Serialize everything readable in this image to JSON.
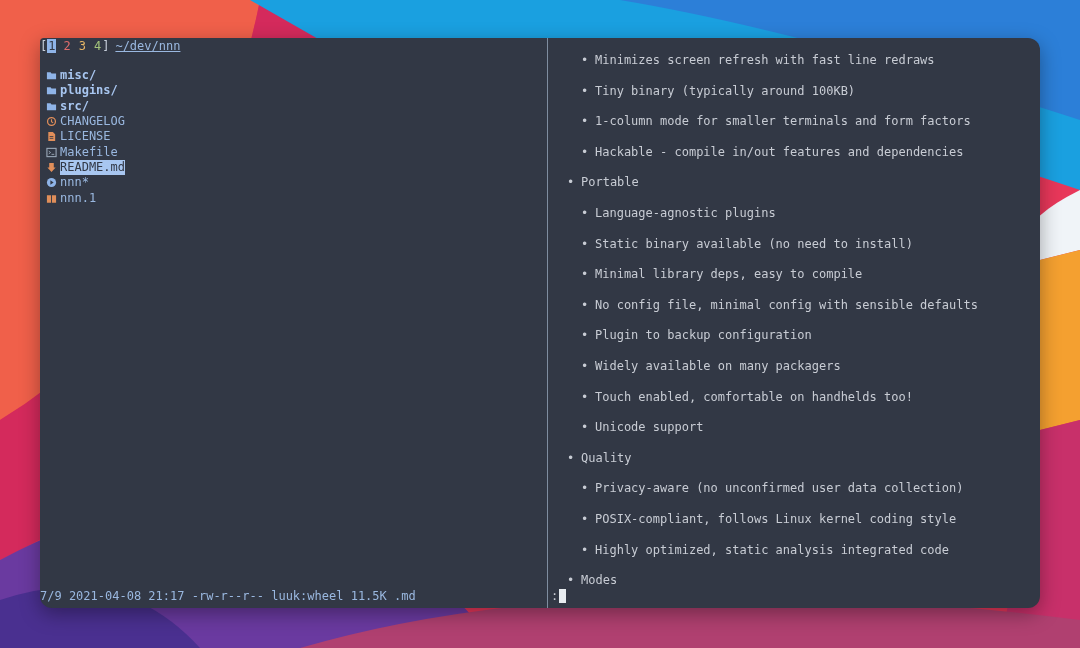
{
  "left_pane": {
    "contexts": [
      {
        "label": "1",
        "selected": true,
        "color": "#8fb4e8"
      },
      {
        "label": "2",
        "selected": false,
        "color": "#e06c6c"
      },
      {
        "label": "3",
        "selected": false,
        "color": "#e5b566"
      },
      {
        "label": "4",
        "selected": false,
        "color": "#a3c47a"
      }
    ],
    "open_bracket": "[",
    "close_bracket": "]",
    "path": "~/dev/nnn",
    "files": [
      {
        "name": "misc/",
        "kind": "directory",
        "selected": false
      },
      {
        "name": "plugins/",
        "kind": "directory",
        "selected": false
      },
      {
        "name": "src/",
        "kind": "directory",
        "selected": false
      },
      {
        "name": "CHANGELOG",
        "kind": "changelog",
        "selected": false
      },
      {
        "name": "LICENSE",
        "kind": "text",
        "selected": false
      },
      {
        "name": "Makefile",
        "kind": "makefile",
        "selected": false
      },
      {
        "name": "README.md",
        "kind": "markdown",
        "selected": true
      },
      {
        "name": "nnn*",
        "kind": "executable",
        "selected": false
      },
      {
        "name": "nnn.1",
        "kind": "manpage",
        "selected": false
      }
    ],
    "status": "7/9 2021-04-08 21:17 -rw-r--r-- luuk:wheel 11.5K .md"
  },
  "preview": {
    "bullet": "•",
    "continued_items": [
      "Minimizes screen refresh with fast line redraws",
      "Tiny binary (typically around 100KB)",
      "1-column mode for smaller terminals and form factors",
      "Hackable - compile in/out features and dependencies"
    ],
    "items": [
      {
        "text": "Portable",
        "children": [
          "Language-agnostic plugins",
          "Static binary available (no need to install)",
          "Minimal library deps, easy to compile",
          "No config file, minimal config with sensible defaults",
          "Plugin to backup configuration",
          "Widely available on many packagers",
          "Touch enabled, comfortable on handhelds too!",
          "Unicode support"
        ]
      },
      {
        "text": "Quality",
        "children": [
          "Privacy-aware (no unconfirmed user data collection)",
          "POSIX-compliant, follows Linux kernel coding style",
          "Highly optimized, static analysis integrated code"
        ]
      },
      {
        "text": "Modes"
      }
    ],
    "prompt": ":"
  }
}
